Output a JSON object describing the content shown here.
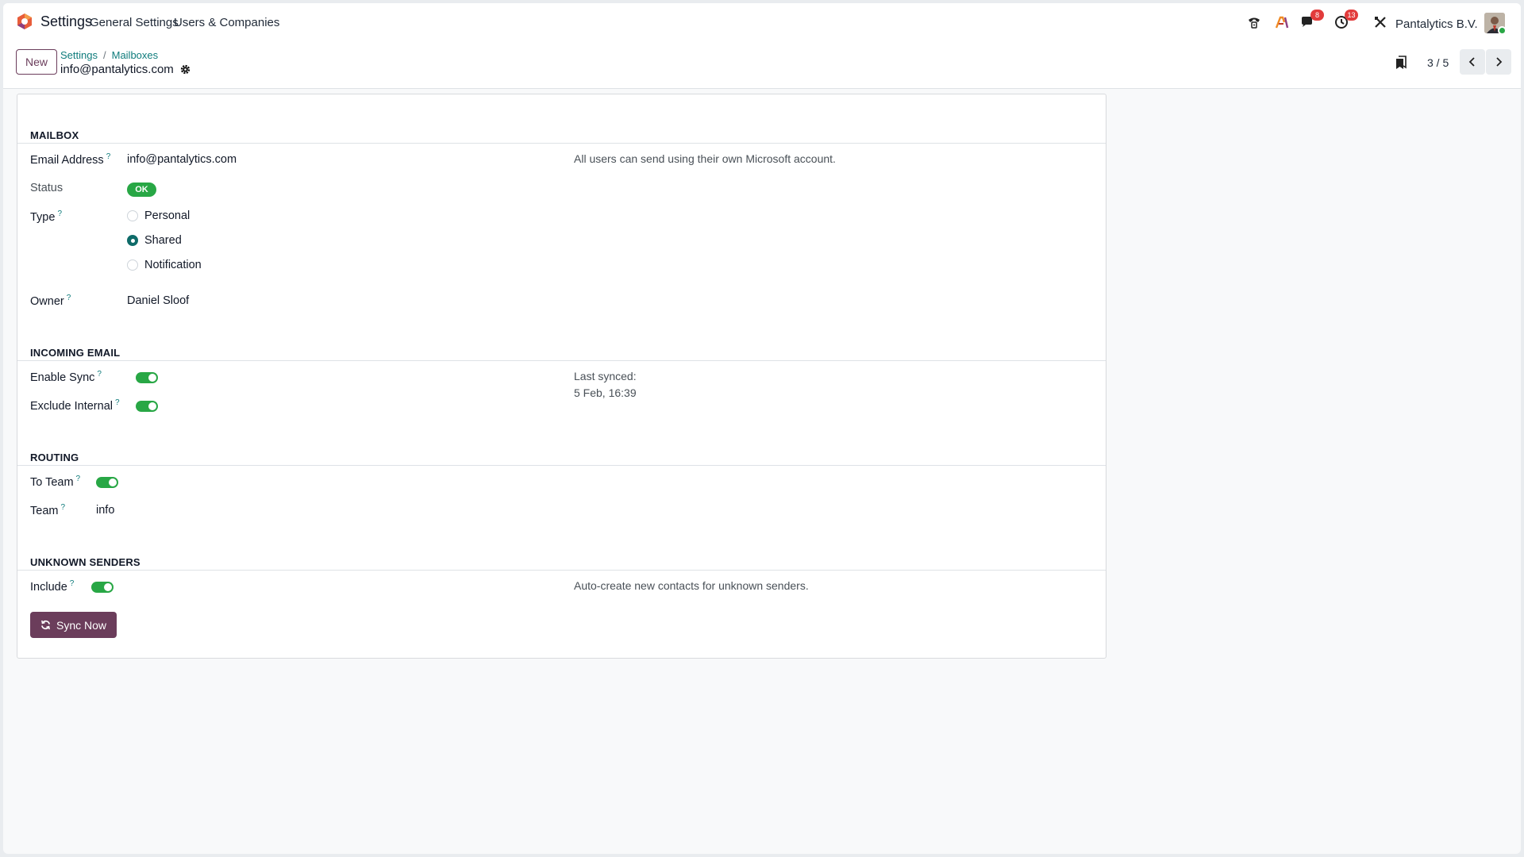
{
  "navbar": {
    "app_name": "Settings",
    "menu": [
      "General Settings",
      "Users & Companies"
    ],
    "messages_count": "8",
    "activities_count": "13",
    "company": "Pantalytics B.V."
  },
  "control_panel": {
    "new_label": "New",
    "breadcrumb": [
      "Settings",
      "Mailboxes"
    ],
    "record_title": "info@pantalytics.com",
    "pager": "3 / 5"
  },
  "form": {
    "mailbox": {
      "title": "MAILBOX",
      "email_label": "Email Address",
      "email_value": "info@pantalytics.com",
      "email_note": "All users can send using their own Microsoft account.",
      "status_label": "Status",
      "status_value": "OK",
      "type_label": "Type",
      "type_options": [
        "Personal",
        "Shared",
        "Notification"
      ],
      "type_selected": "Shared",
      "owner_label": "Owner",
      "owner_value": "Daniel Sloof"
    },
    "incoming": {
      "title": "INCOMING EMAIL",
      "sync_label": "Enable Sync",
      "sync_enabled": true,
      "exclude_label": "Exclude Internal",
      "exclude_enabled": true,
      "last_synced_label": "Last synced:",
      "last_synced_value": "5 Feb, 16:39"
    },
    "routing": {
      "title": "ROUTING",
      "to_team_label": "To Team",
      "to_team_enabled": true,
      "team_label": "Team",
      "team_value": "info"
    },
    "unknown": {
      "title": "UNKNOWN SENDERS",
      "include_label": "Include",
      "include_enabled": true,
      "include_note": "Auto-create new contacts for unknown senders."
    },
    "sync_button": "Sync Now"
  },
  "colors": {
    "brand": "#6b3d5b",
    "accent_teal": "#0f7c7c",
    "success": "#28a745",
    "badge_red": "#e23b3b"
  }
}
